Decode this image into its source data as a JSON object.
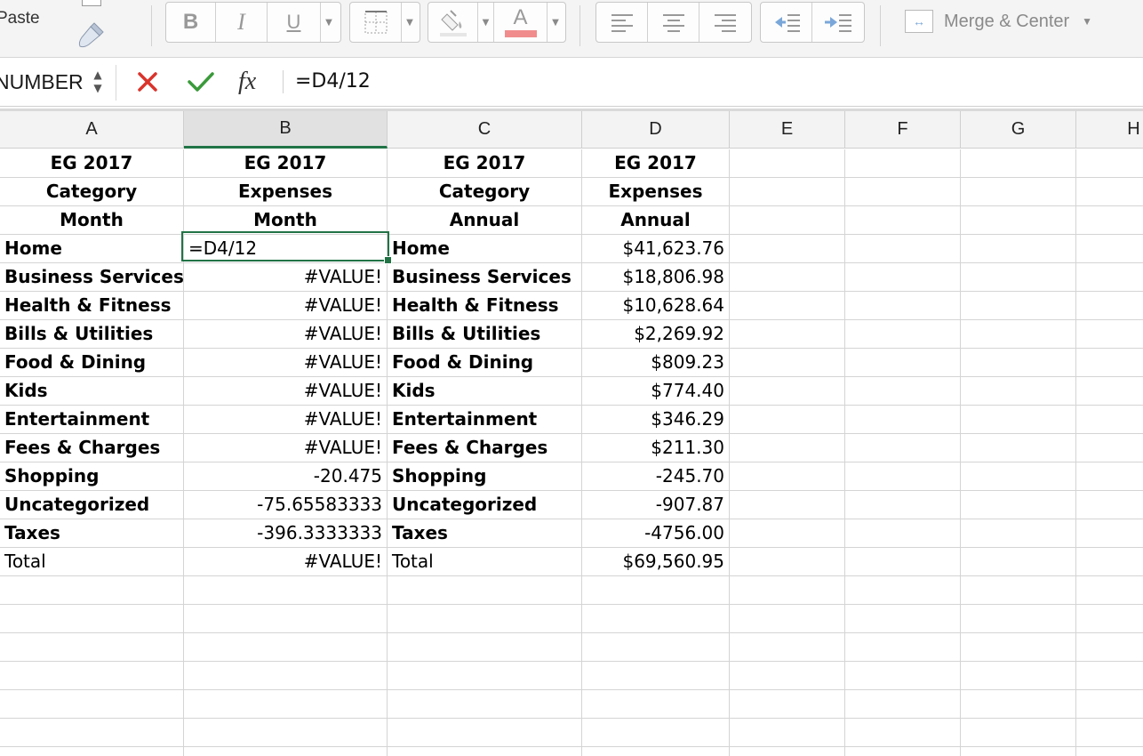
{
  "ribbon": {
    "paste_label": "Paste",
    "bold": "B",
    "italic": "I",
    "underline": "U",
    "font_color_letter": "A",
    "font_color_swatch": "#f08c8c",
    "merge_label": "Merge & Center"
  },
  "formula_bar": {
    "name_box": "NUMBER",
    "fx": "fx",
    "formula": "=D4/12",
    "cancel_color": "#d9342b",
    "confirm_color": "#3a9a3a"
  },
  "grid": {
    "columns": [
      "A",
      "B",
      "C",
      "D",
      "E",
      "F",
      "G",
      "H"
    ],
    "active_column": "B",
    "active_cell": "B4",
    "active_cell_edit_value": "=D4/12",
    "header_rows": [
      [
        "EG 2017",
        "EG 2017",
        "EG 2017",
        "EG 2017"
      ],
      [
        "Category",
        "Expenses",
        "Category",
        "Expenses"
      ],
      [
        "Month",
        "Month",
        "Annual",
        "Annual"
      ]
    ],
    "data_rows": [
      {
        "a": "Home",
        "b": "=D4/12",
        "c": "Home",
        "d": "$41,623.76"
      },
      {
        "a": "Business Services",
        "b": "#VALUE!",
        "c": "Business Services",
        "d": "$18,806.98"
      },
      {
        "a": "Health & Fitness",
        "b": "#VALUE!",
        "c": "Health & Fitness",
        "d": "$10,628.64"
      },
      {
        "a": "Bills & Utilities",
        "b": "#VALUE!",
        "c": "Bills & Utilities",
        "d": "$2,269.92"
      },
      {
        "a": "Food & Dining",
        "b": "#VALUE!",
        "c": "Food & Dining",
        "d": "$809.23"
      },
      {
        "a": "Kids",
        "b": "#VALUE!",
        "c": "Kids",
        "d": "$774.40"
      },
      {
        "a": "Entertainment",
        "b": "#VALUE!",
        "c": "Entertainment",
        "d": "$346.29"
      },
      {
        "a": "Fees & Charges",
        "b": "#VALUE!",
        "c": "Fees & Charges",
        "d": "$211.30"
      },
      {
        "a": "Shopping",
        "b": "-20.475",
        "c": "Shopping",
        "d": "-245.70"
      },
      {
        "a": "Uncategorized",
        "b": "-75.65583333",
        "c": "Uncategorized",
        "d": "-907.87"
      },
      {
        "a": "Taxes",
        "b": "-396.3333333",
        "c": "Taxes",
        "d": "-4756.00"
      }
    ],
    "total_row": {
      "a": "Total",
      "b": "#VALUE!",
      "c": "Total",
      "d": "$69,560.95"
    },
    "accent_color": "#217346"
  }
}
